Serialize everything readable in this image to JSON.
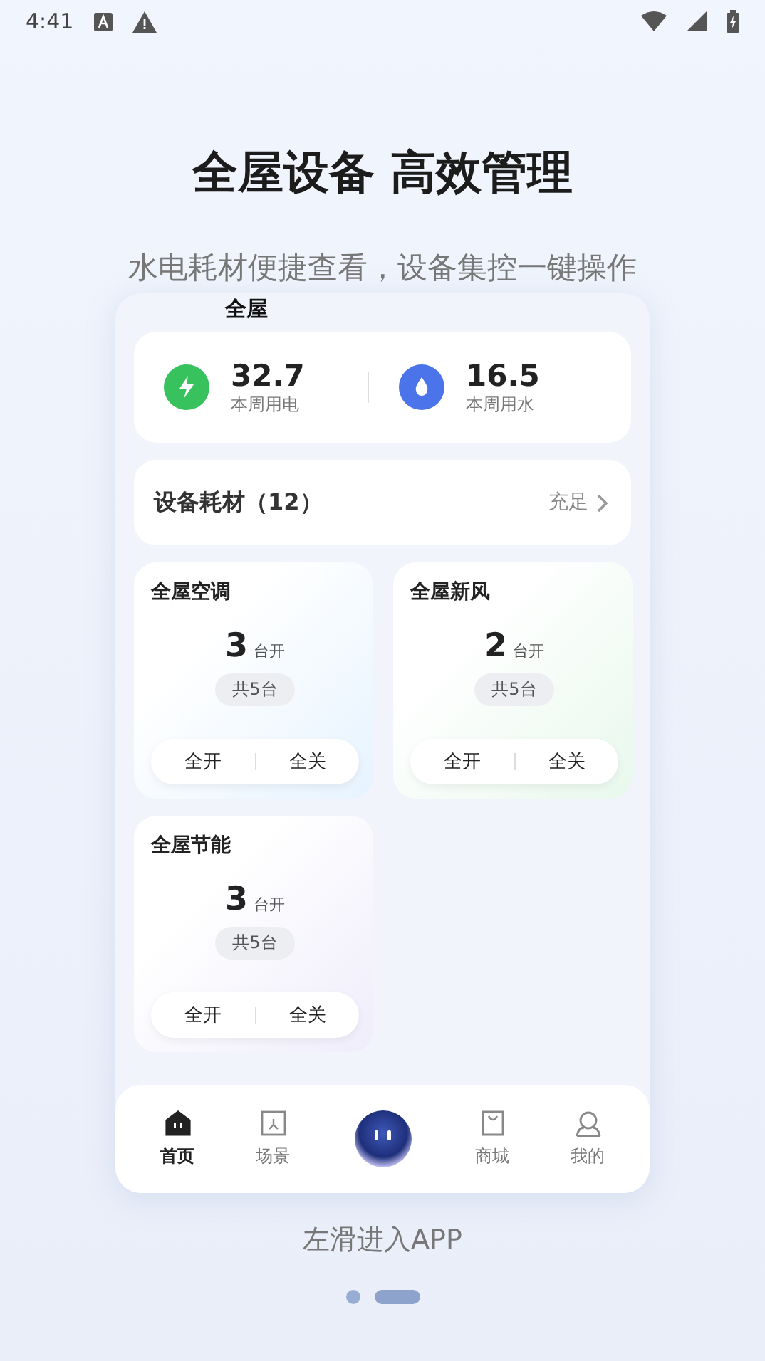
{
  "status_bar": {
    "time": "4:41"
  },
  "headline": "全屋设备 高效管理",
  "subtitle": "水电耗材便捷查看，设备集控一键操作",
  "phone": {
    "header": "全屋",
    "stats": [
      {
        "kind": "power",
        "value": "32.7",
        "label": "本周用电"
      },
      {
        "kind": "water",
        "value": "16.5",
        "label": "本周用水"
      }
    ],
    "consumables": {
      "title": "设备耗材（12）",
      "status": "充足"
    },
    "groups": [
      {
        "name": "全屋空调",
        "count": "3",
        "unit": "台开",
        "total": "共5台",
        "on": "全开",
        "off": "全关",
        "color": "#e6f3ff"
      },
      {
        "name": "全屋新风",
        "count": "2",
        "unit": "台开",
        "total": "共5台",
        "on": "全开",
        "off": "全关",
        "color": "#e8f8ec"
      },
      {
        "name": "全屋节能",
        "count": "3",
        "unit": "台开",
        "total": "共5台",
        "on": "全开",
        "off": "全关",
        "color": "#efedfb"
      }
    ],
    "tabs": [
      {
        "kind": "home",
        "label": "首页",
        "selected": true
      },
      {
        "kind": "scene",
        "label": "场景",
        "selected": false
      },
      {
        "kind": "robot",
        "selected": false
      },
      {
        "kind": "shop",
        "label": "商城",
        "selected": false
      },
      {
        "kind": "me",
        "label": "我的",
        "selected": false
      }
    ]
  },
  "hint": "左滑进入APP",
  "pages": [
    {
      "selected": false
    },
    {
      "selected": true
    }
  ]
}
